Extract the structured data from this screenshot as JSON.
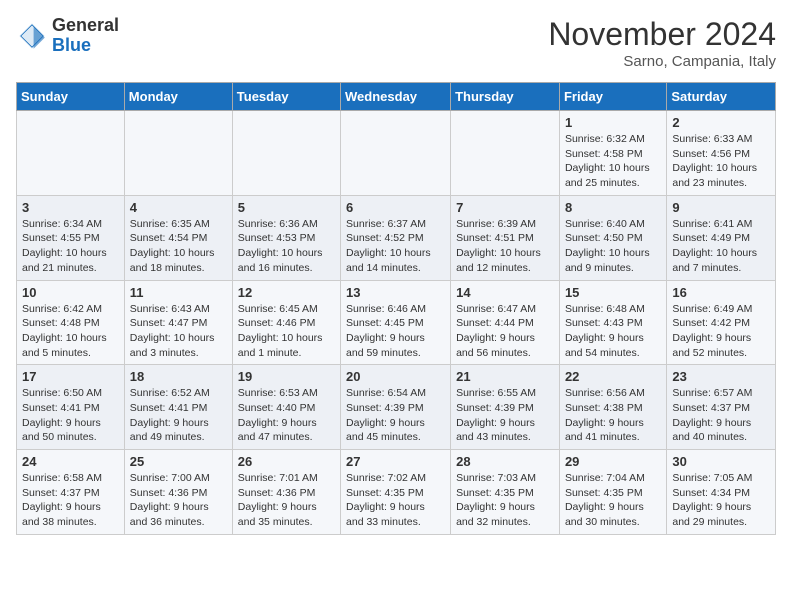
{
  "header": {
    "logo_general": "General",
    "logo_blue": "Blue",
    "month_title": "November 2024",
    "location": "Sarno, Campania, Italy"
  },
  "days_of_week": [
    "Sunday",
    "Monday",
    "Tuesday",
    "Wednesday",
    "Thursday",
    "Friday",
    "Saturday"
  ],
  "weeks": [
    [
      {
        "num": "",
        "info": ""
      },
      {
        "num": "",
        "info": ""
      },
      {
        "num": "",
        "info": ""
      },
      {
        "num": "",
        "info": ""
      },
      {
        "num": "",
        "info": ""
      },
      {
        "num": "1",
        "info": "Sunrise: 6:32 AM\nSunset: 4:58 PM\nDaylight: 10 hours and 25 minutes."
      },
      {
        "num": "2",
        "info": "Sunrise: 6:33 AM\nSunset: 4:56 PM\nDaylight: 10 hours and 23 minutes."
      }
    ],
    [
      {
        "num": "3",
        "info": "Sunrise: 6:34 AM\nSunset: 4:55 PM\nDaylight: 10 hours and 21 minutes."
      },
      {
        "num": "4",
        "info": "Sunrise: 6:35 AM\nSunset: 4:54 PM\nDaylight: 10 hours and 18 minutes."
      },
      {
        "num": "5",
        "info": "Sunrise: 6:36 AM\nSunset: 4:53 PM\nDaylight: 10 hours and 16 minutes."
      },
      {
        "num": "6",
        "info": "Sunrise: 6:37 AM\nSunset: 4:52 PM\nDaylight: 10 hours and 14 minutes."
      },
      {
        "num": "7",
        "info": "Sunrise: 6:39 AM\nSunset: 4:51 PM\nDaylight: 10 hours and 12 minutes."
      },
      {
        "num": "8",
        "info": "Sunrise: 6:40 AM\nSunset: 4:50 PM\nDaylight: 10 hours and 9 minutes."
      },
      {
        "num": "9",
        "info": "Sunrise: 6:41 AM\nSunset: 4:49 PM\nDaylight: 10 hours and 7 minutes."
      }
    ],
    [
      {
        "num": "10",
        "info": "Sunrise: 6:42 AM\nSunset: 4:48 PM\nDaylight: 10 hours and 5 minutes."
      },
      {
        "num": "11",
        "info": "Sunrise: 6:43 AM\nSunset: 4:47 PM\nDaylight: 10 hours and 3 minutes."
      },
      {
        "num": "12",
        "info": "Sunrise: 6:45 AM\nSunset: 4:46 PM\nDaylight: 10 hours and 1 minute."
      },
      {
        "num": "13",
        "info": "Sunrise: 6:46 AM\nSunset: 4:45 PM\nDaylight: 9 hours and 59 minutes."
      },
      {
        "num": "14",
        "info": "Sunrise: 6:47 AM\nSunset: 4:44 PM\nDaylight: 9 hours and 56 minutes."
      },
      {
        "num": "15",
        "info": "Sunrise: 6:48 AM\nSunset: 4:43 PM\nDaylight: 9 hours and 54 minutes."
      },
      {
        "num": "16",
        "info": "Sunrise: 6:49 AM\nSunset: 4:42 PM\nDaylight: 9 hours and 52 minutes."
      }
    ],
    [
      {
        "num": "17",
        "info": "Sunrise: 6:50 AM\nSunset: 4:41 PM\nDaylight: 9 hours and 50 minutes."
      },
      {
        "num": "18",
        "info": "Sunrise: 6:52 AM\nSunset: 4:41 PM\nDaylight: 9 hours and 49 minutes."
      },
      {
        "num": "19",
        "info": "Sunrise: 6:53 AM\nSunset: 4:40 PM\nDaylight: 9 hours and 47 minutes."
      },
      {
        "num": "20",
        "info": "Sunrise: 6:54 AM\nSunset: 4:39 PM\nDaylight: 9 hours and 45 minutes."
      },
      {
        "num": "21",
        "info": "Sunrise: 6:55 AM\nSunset: 4:39 PM\nDaylight: 9 hours and 43 minutes."
      },
      {
        "num": "22",
        "info": "Sunrise: 6:56 AM\nSunset: 4:38 PM\nDaylight: 9 hours and 41 minutes."
      },
      {
        "num": "23",
        "info": "Sunrise: 6:57 AM\nSunset: 4:37 PM\nDaylight: 9 hours and 40 minutes."
      }
    ],
    [
      {
        "num": "24",
        "info": "Sunrise: 6:58 AM\nSunset: 4:37 PM\nDaylight: 9 hours and 38 minutes."
      },
      {
        "num": "25",
        "info": "Sunrise: 7:00 AM\nSunset: 4:36 PM\nDaylight: 9 hours and 36 minutes."
      },
      {
        "num": "26",
        "info": "Sunrise: 7:01 AM\nSunset: 4:36 PM\nDaylight: 9 hours and 35 minutes."
      },
      {
        "num": "27",
        "info": "Sunrise: 7:02 AM\nSunset: 4:35 PM\nDaylight: 9 hours and 33 minutes."
      },
      {
        "num": "28",
        "info": "Sunrise: 7:03 AM\nSunset: 4:35 PM\nDaylight: 9 hours and 32 minutes."
      },
      {
        "num": "29",
        "info": "Sunrise: 7:04 AM\nSunset: 4:35 PM\nDaylight: 9 hours and 30 minutes."
      },
      {
        "num": "30",
        "info": "Sunrise: 7:05 AM\nSunset: 4:34 PM\nDaylight: 9 hours and 29 minutes."
      }
    ]
  ]
}
